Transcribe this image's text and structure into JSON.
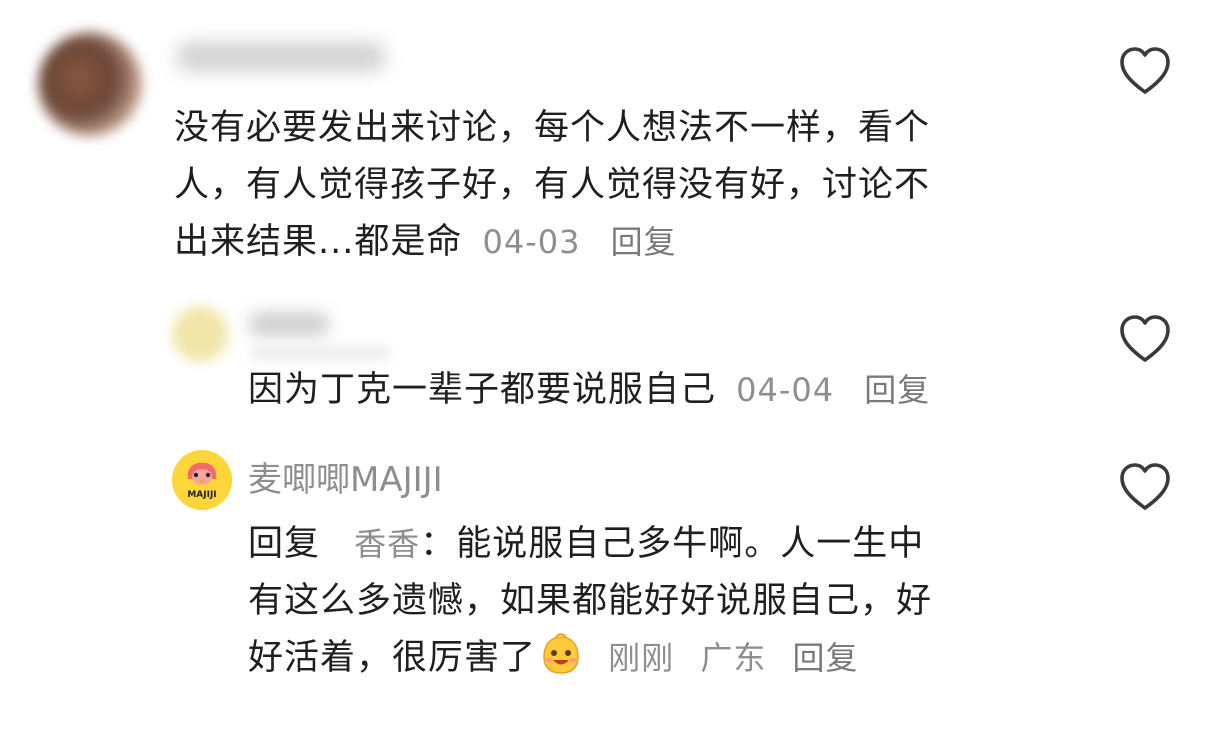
{
  "comments": [
    {
      "text_lines": [
        "没有必要发出来讨论，每个人想法不一样，看个",
        "人，有人觉得孩子好，有人觉得没有好，讨论不",
        "出来结果...都是命"
      ],
      "date": "04-03",
      "reply_label": "回复",
      "like_icon": "heart-outline-icon"
    },
    {
      "text": "因为丁克一辈子都要说服自己",
      "date": "04-04",
      "reply_label": "回复",
      "like_icon": "heart-outline-icon"
    },
    {
      "username": "麦唧唧MAJIJI",
      "avatar_label": "MAJIJI",
      "reply_prefix": "回复",
      "reply_to": "香香",
      "colon": "：",
      "line1": "能说服自己多牛啊。人一生中",
      "line2": "有这么多遗憾，如果都能好好说服自己，好",
      "line3": "好活着，很厉害了",
      "emoji_icon": "grinning-face-emoji-icon",
      "time": "刚刚",
      "location": "广东",
      "reply_label": "回复",
      "like_icon": "heart-outline-icon"
    }
  ]
}
